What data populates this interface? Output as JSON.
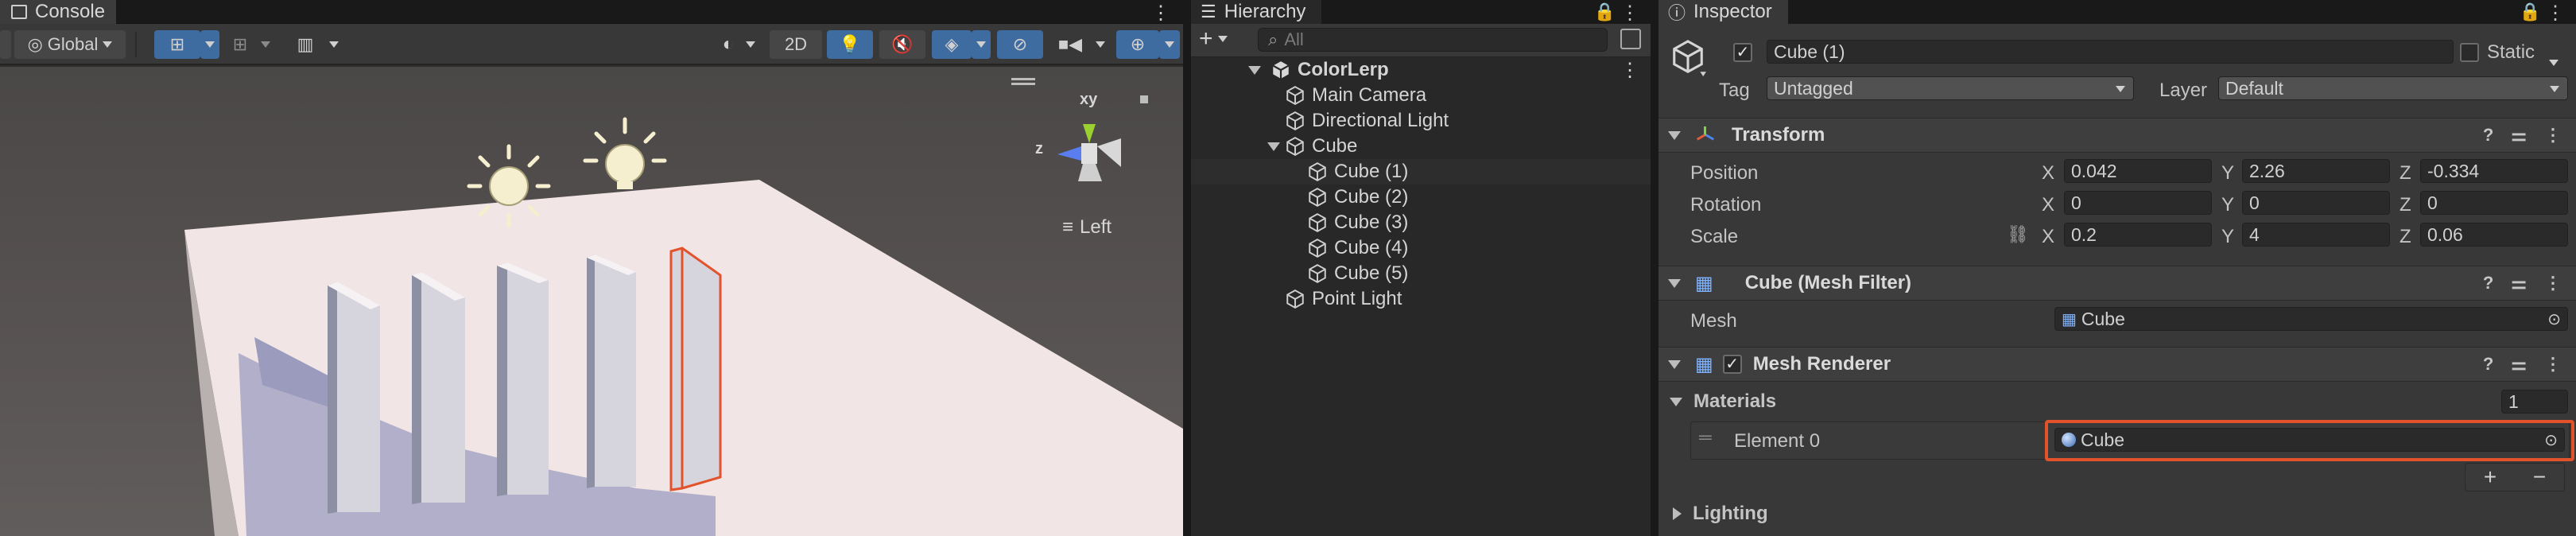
{
  "scene": {
    "tab_label": "Console",
    "pivot_label": "Global",
    "mode_2d": "2D",
    "orientation_label": "Left",
    "axis_labels": {
      "y": "xy",
      "z": "z"
    }
  },
  "hierarchy": {
    "tab_label": "Hierarchy",
    "add_label": "+",
    "search_placeholder": "All",
    "items": [
      {
        "label": "ColorLerp",
        "level": 0,
        "expanded": true,
        "icon": "unity-scene-icon"
      },
      {
        "label": "Main Camera",
        "level": 1,
        "icon": "cube-icon"
      },
      {
        "label": "Directional Light",
        "level": 1,
        "icon": "cube-icon"
      },
      {
        "label": "Cube",
        "level": 1,
        "expanded": true,
        "icon": "cube-icon"
      },
      {
        "label": "Cube (1)",
        "level": 2,
        "selected": true,
        "icon": "cube-icon"
      },
      {
        "label": "Cube (2)",
        "level": 2,
        "icon": "cube-icon"
      },
      {
        "label": "Cube (3)",
        "level": 2,
        "icon": "cube-icon"
      },
      {
        "label": "Cube (4)",
        "level": 2,
        "icon": "cube-icon"
      },
      {
        "label": "Cube (5)",
        "level": 2,
        "icon": "cube-icon"
      },
      {
        "label": "Point Light",
        "level": 1,
        "icon": "cube-icon"
      }
    ]
  },
  "inspector": {
    "tab_label": "Inspector",
    "object_name": "Cube (1)",
    "static_label": "Static",
    "tag_label": "Tag",
    "tag_value": "Untagged",
    "layer_label": "Layer",
    "layer_value": "Default",
    "transform": {
      "title": "Transform",
      "position": {
        "label": "Position",
        "x": "0.042",
        "y": "2.26",
        "z": "-0.334"
      },
      "rotation": {
        "label": "Rotation",
        "x": "0",
        "y": "0",
        "z": "0"
      },
      "scale": {
        "label": "Scale",
        "x": "0.2",
        "y": "4",
        "z": "0.06"
      },
      "axis_x": "X",
      "axis_y": "Y",
      "axis_z": "Z"
    },
    "mesh_filter": {
      "title": "Cube (Mesh Filter)",
      "mesh_label": "Mesh",
      "mesh_value": "Cube"
    },
    "mesh_renderer": {
      "title": "Mesh Renderer",
      "materials_label": "Materials",
      "materials_count": "1",
      "element_label": "Element 0",
      "element_value": "Cube",
      "add_label": "+",
      "remove_label": "−"
    },
    "lighting_label": "Lighting"
  },
  "colors": {
    "highlight": "#e2522b",
    "accent_blue": "#3f6ca0",
    "selection": "#2d2d2d"
  }
}
